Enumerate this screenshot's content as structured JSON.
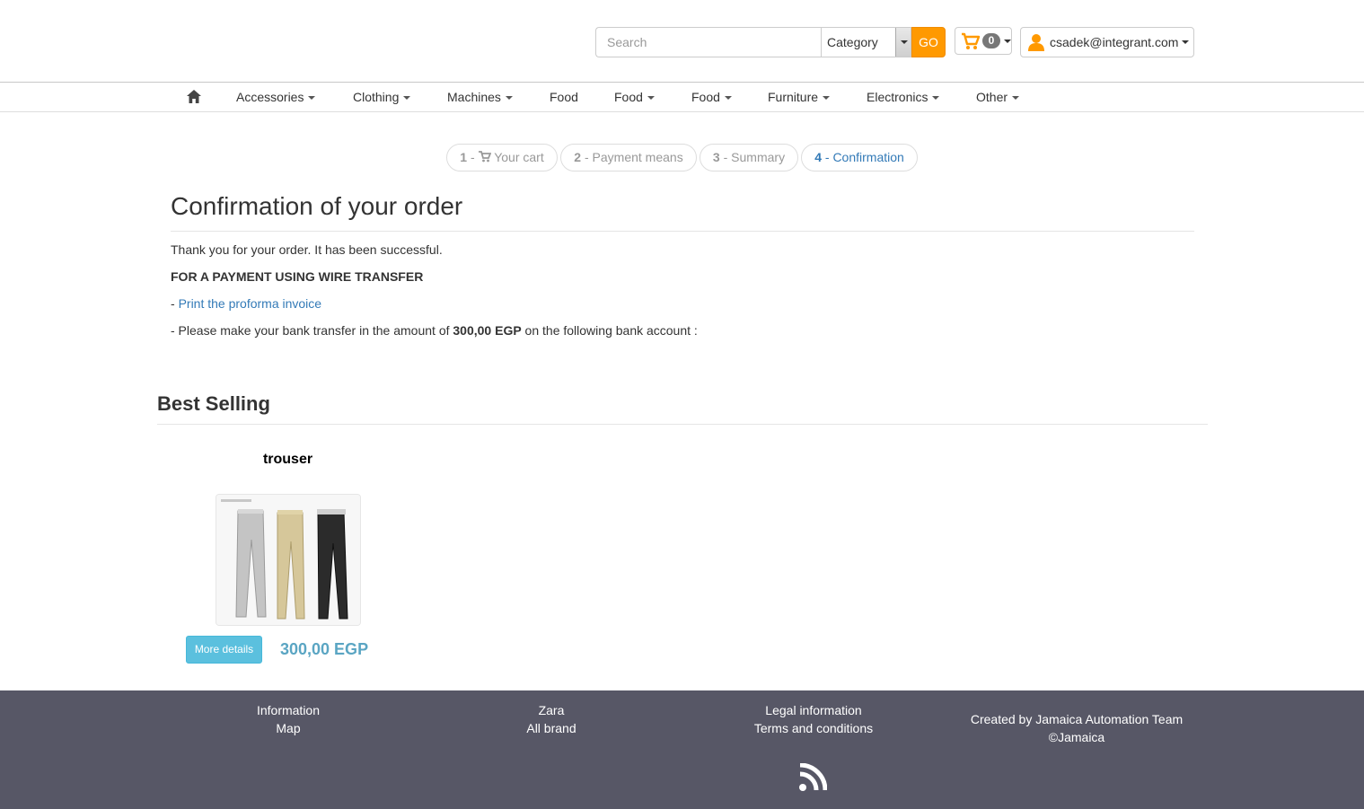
{
  "header": {
    "search_placeholder": "Search",
    "category_label": "Category",
    "go_label": "GO",
    "cart_count": "0",
    "user_email": "csadek@integrant.com"
  },
  "nav": {
    "items": [
      {
        "label": "Accessories",
        "dropdown": true
      },
      {
        "label": "Clothing",
        "dropdown": true
      },
      {
        "label": "Machines",
        "dropdown": true
      },
      {
        "label": "Food",
        "dropdown": false
      },
      {
        "label": "Food",
        "dropdown": true
      },
      {
        "label": "Food",
        "dropdown": true
      },
      {
        "label": "Furniture",
        "dropdown": true
      },
      {
        "label": "Electronics",
        "dropdown": true
      },
      {
        "label": "Other",
        "dropdown": true
      }
    ]
  },
  "steps": [
    {
      "number": "1",
      "label": "Your cart"
    },
    {
      "number": "2",
      "label": "Payment means"
    },
    {
      "number": "3",
      "label": "Summary"
    },
    {
      "number": "4",
      "label": "Confirmation"
    }
  ],
  "confirmation": {
    "title": "Confirmation of your order",
    "thanks": "Thank you for your order. It has been successful.",
    "wire_heading": "FOR A PAYMENT USING WIRE TRANSFER",
    "print_link": "Print the proforma invoice",
    "transfer_prefix": "- Please make your bank transfer in the amount of ",
    "transfer_amount": "300,00 EGP",
    "transfer_suffix": " on the following bank account :"
  },
  "best_selling": {
    "title": "Best Selling",
    "product": {
      "name": "trouser",
      "button_label": "More details",
      "price": "300,00 EGP"
    }
  },
  "footer": {
    "col1": [
      "Information",
      "Map"
    ],
    "col2": [
      "Zara",
      "All brand"
    ],
    "col3": [
      "Legal information",
      "Terms and conditions"
    ],
    "col4": [
      "Created by Jamaica Automation Team",
      "©Jamaica"
    ]
  },
  "colors": {
    "accent_orange": "#ff9900",
    "link_blue": "#337ab7",
    "info_button": "#5bc0de",
    "footer_bg": "#575766"
  }
}
